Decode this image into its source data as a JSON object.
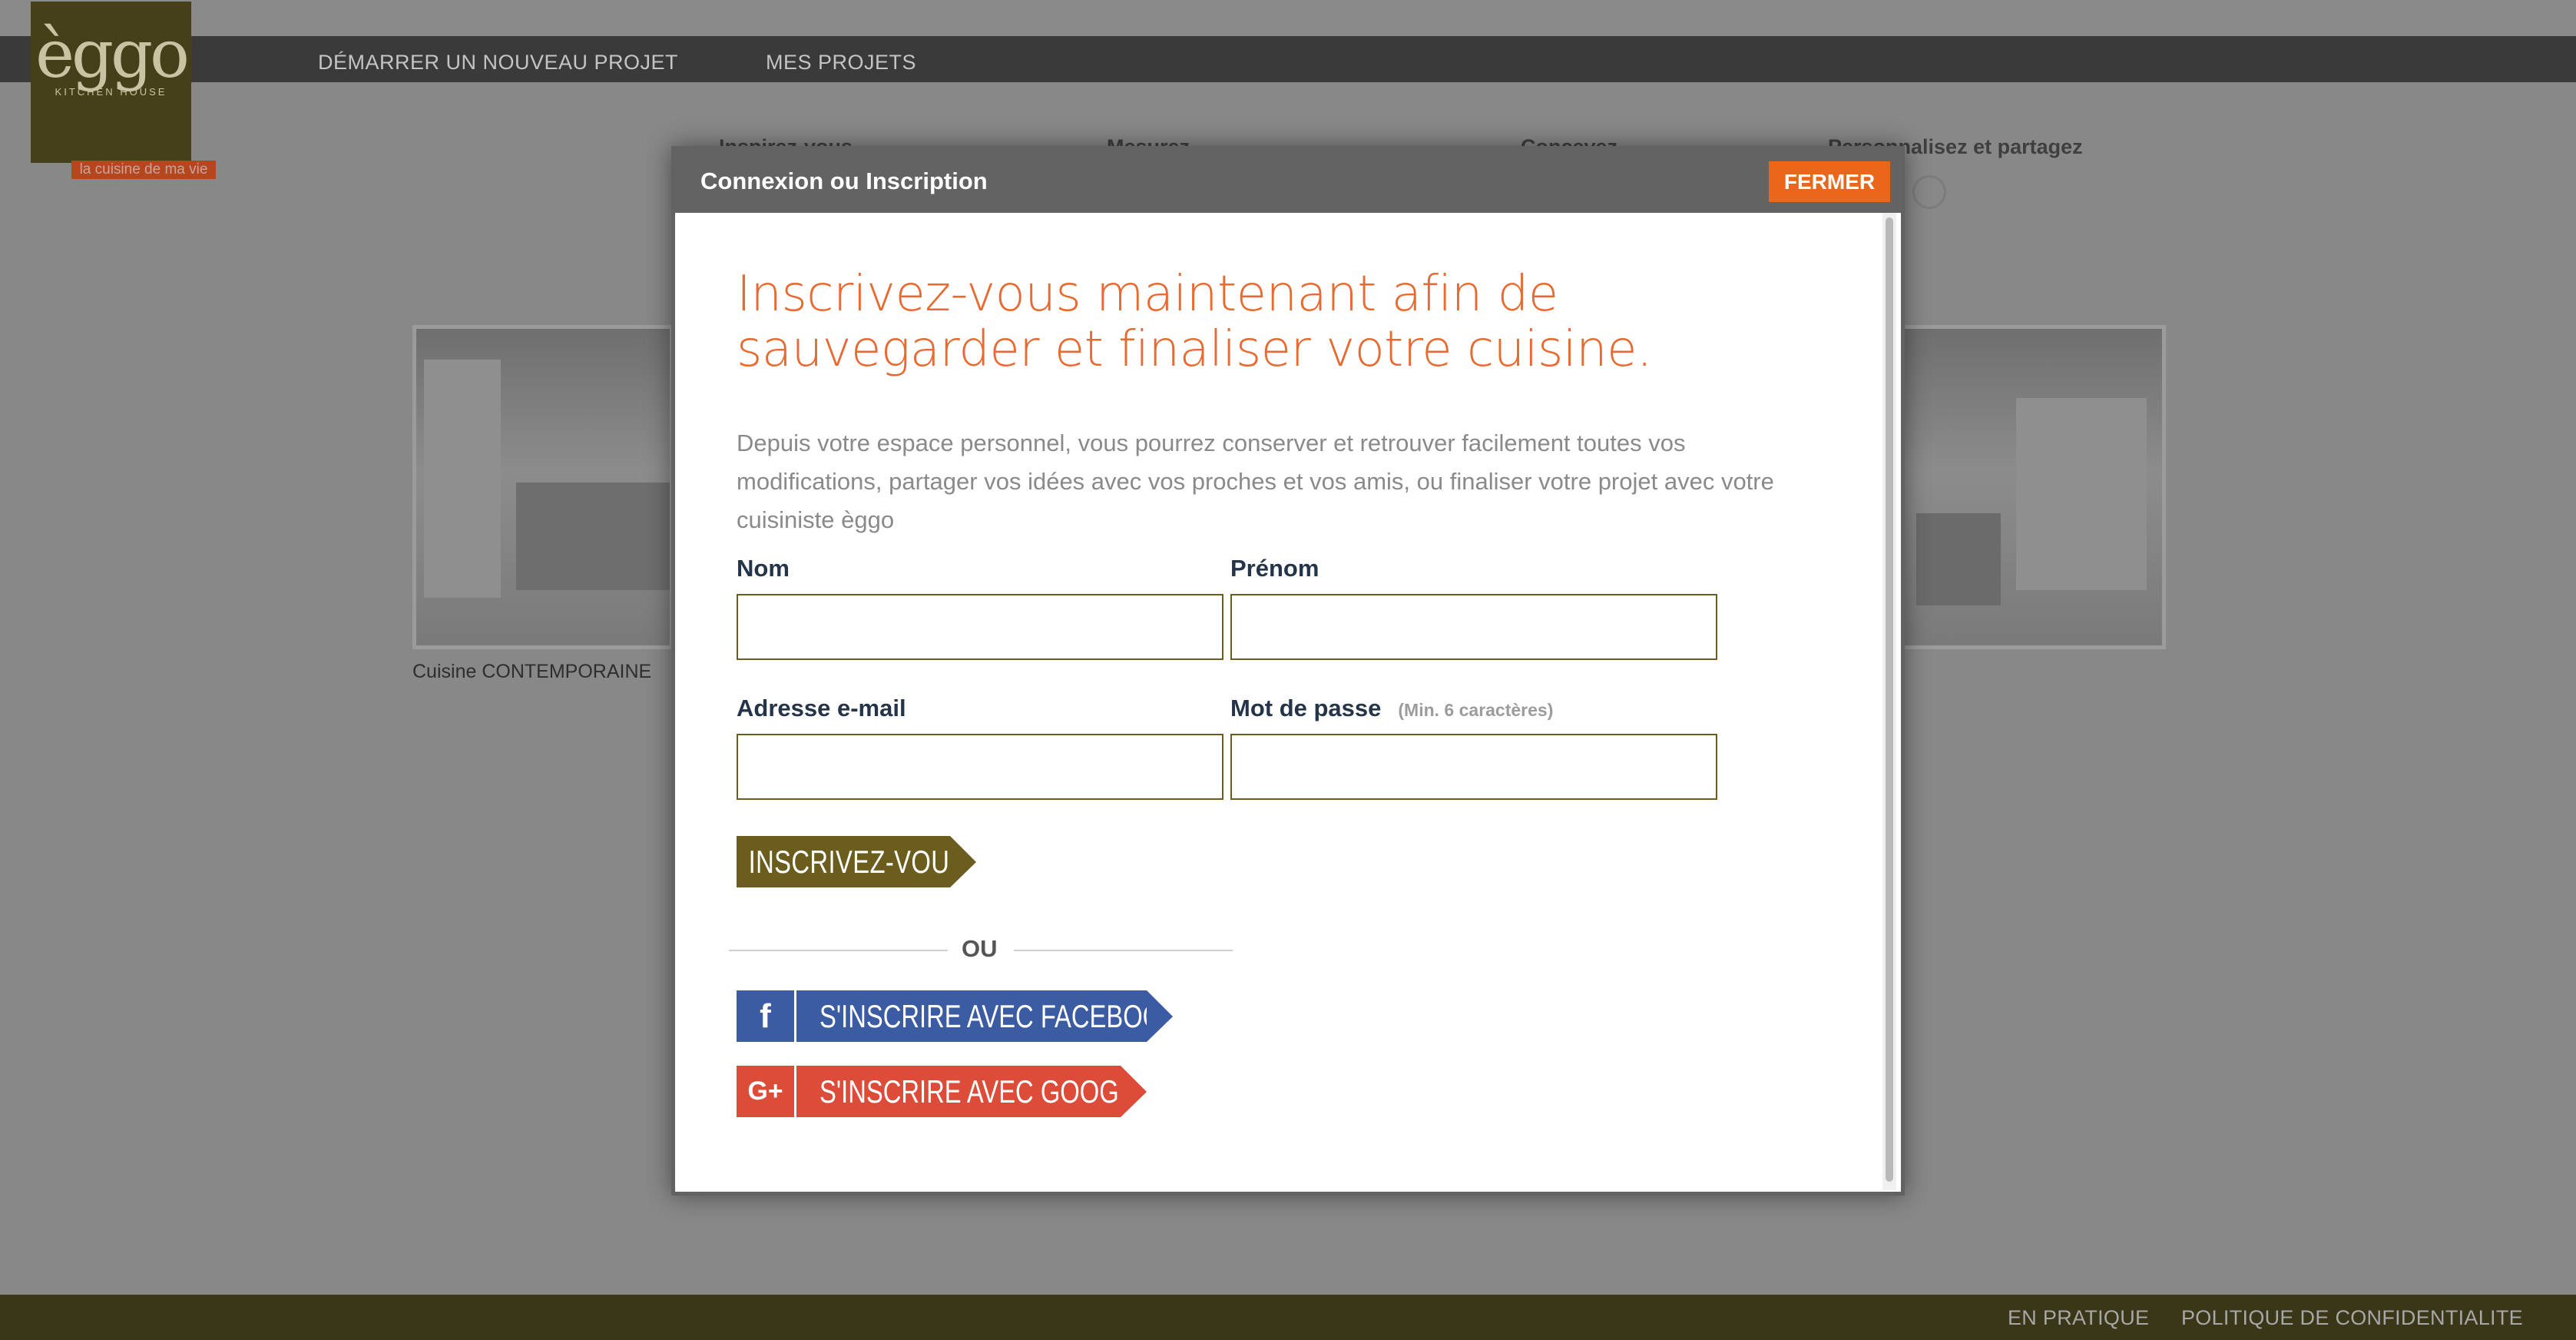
{
  "colors": {
    "accent_orange": "#e86a30",
    "close_orange": "#e9661a",
    "olive": "#6b5d1e",
    "facebook_blue": "#3b5ba3",
    "google_red": "#dd4b39",
    "header_gray": "#636363"
  },
  "brand": {
    "logo_word": "èggo",
    "logo_sub": "KITCHEN HOUSE",
    "tagline": "la cuisine de ma vie"
  },
  "nav": {
    "items": [
      "DÉMARRER UN NOUVEAU PROJET",
      "MES PROJETS"
    ]
  },
  "steps": [
    "Inspirez-vous",
    "Mesurez",
    "Concevez",
    "Personnalisez et partagez"
  ],
  "gallery": {
    "caption": "Cuisine CONTEMPORAINE"
  },
  "footer": {
    "links": [
      "EN PRATIQUE",
      "POLITIQUE DE CONFIDENTIALITE"
    ]
  },
  "modal": {
    "title": "Connexion ou Inscription",
    "close_label": "FERMER",
    "headline": "Inscrivez-vous maintenant afin de sauvegarder et finaliser votre cuisine.",
    "description": "Depuis votre espace personnel, vous pourrez conserver et retrouver facilement toutes vos modifications, partager vos idées avec vos proches et vos amis, ou finaliser votre projet avec votre cuisiniste èggo",
    "fields": {
      "nom_label": "Nom",
      "prenom_label": "Prénom",
      "email_label": "Adresse e-mail",
      "password_label": "Mot de passe",
      "password_hint": "(Min. 6 caractères)",
      "nom_value": "",
      "prenom_value": "",
      "email_value": "",
      "password_value": ""
    },
    "submit_label": "INSCRIVEZ-VOUS",
    "or_label": "OU",
    "facebook": {
      "icon": "f",
      "label": "S'INSCRIRE AVEC FACEBOOK"
    },
    "google": {
      "icon": "G+",
      "label": "S'INSCRIRE AVEC GOOGLE"
    }
  }
}
